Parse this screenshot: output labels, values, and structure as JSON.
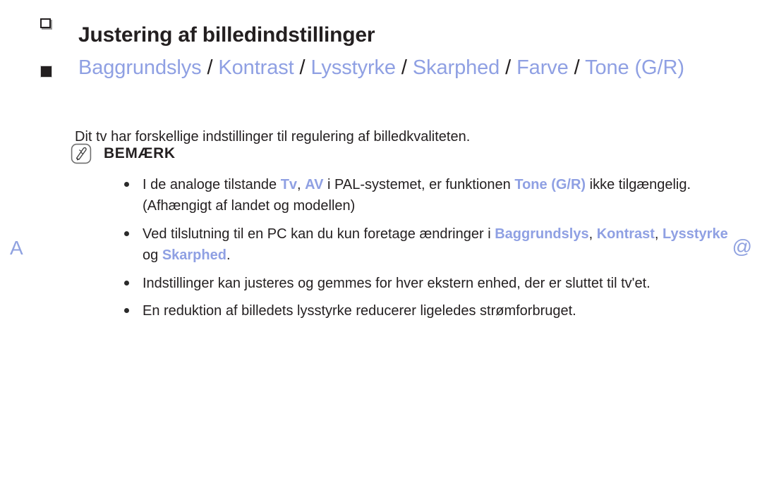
{
  "page": {
    "language": "da",
    "accent_color": "#8fa0e3",
    "text_color": "#231f20",
    "background": "#ffffff"
  },
  "side_markers": {
    "left": "A",
    "right": "@"
  },
  "title": {
    "bullet_icon": "outlined-square-icon",
    "text": "Justering af billedindstillinger"
  },
  "heading": {
    "bullet_icon": "filled-square-icon",
    "parts": [
      {
        "text": "Baggrundslys",
        "style": "link"
      },
      {
        "text": " / ",
        "style": "separator"
      },
      {
        "text": "Kontrast",
        "style": "link"
      },
      {
        "text": " / ",
        "style": "separator"
      },
      {
        "text": "Lysstyrke",
        "style": "link"
      },
      {
        "text": " / ",
        "style": "separator"
      },
      {
        "text": "Skarphed",
        "style": "link"
      },
      {
        "text": " / ",
        "style": "separator"
      },
      {
        "text": "Farve",
        "style": "link"
      },
      {
        "text": " / ",
        "style": "separator"
      },
      {
        "text": "Tone (G/R)",
        "style": "link"
      }
    ],
    "plain": "Baggrundslys / Kontrast / Lysstyrke / Skarphed / Farve / Tone (G/R)"
  },
  "body_paragraph": "Dit tv har forskellige indstillinger til regulering af billedkvaliteten.",
  "note": {
    "icon": "note-pen-icon",
    "label": "BEMÆRK",
    "items": [
      {
        "id": "note-item-1",
        "segments": [
          {
            "text": "I de analoge tilstande ",
            "style": "plain"
          },
          {
            "text": "Tv",
            "style": "link-bold"
          },
          {
            "text": ", ",
            "style": "plain"
          },
          {
            "text": "AV",
            "style": "link-bold"
          },
          {
            "text": " i PAL-systemet, er funktionen ",
            "style": "plain"
          },
          {
            "text": "Tone (G/R)",
            "style": "link-bold"
          },
          {
            "text": " ikke tilgængelig. (Afhængigt af landet og modellen)",
            "style": "plain"
          }
        ],
        "plain": "I de analoge tilstande Tv, AV i PAL-systemet, er funktionen Tone (G/R) ikke tilgængelig. (Afhængigt af landet og modellen)"
      },
      {
        "id": "note-item-2",
        "segments": [
          {
            "text": "Ved tilslutning til en PC kan du kun foretage ændringer i ",
            "style": "plain"
          },
          {
            "text": "Baggrundslys",
            "style": "link-bold"
          },
          {
            "text": ", ",
            "style": "plain"
          },
          {
            "text": "Kontrast",
            "style": "link-bold"
          },
          {
            "text": ", ",
            "style": "plain"
          },
          {
            "text": "Lysstyrke",
            "style": "link-bold"
          },
          {
            "text": " og ",
            "style": "plain"
          },
          {
            "text": "Skarphed",
            "style": "link-bold"
          },
          {
            "text": ".",
            "style": "plain"
          }
        ],
        "plain": "Ved tilslutning til en PC kan du kun foretage ændringer i Baggrundslys, Kontrast, Lysstyrke og Skarphed."
      },
      {
        "id": "note-item-3",
        "segments": [
          {
            "text": "Indstillinger kan justeres og gemmes for hver ekstern enhed, der er sluttet til tv'et.",
            "style": "plain"
          }
        ],
        "plain": "Indstillinger kan justeres og gemmes for hver ekstern enhed, der er sluttet til tv'et."
      },
      {
        "id": "note-item-4",
        "segments": [
          {
            "text": "En reduktion af billedets lysstyrke reducerer ligeledes strømforbruget.",
            "style": "plain"
          }
        ],
        "plain": "En reduktion af billedets lysstyrke reducerer ligeledes strømforbruget."
      }
    ]
  }
}
